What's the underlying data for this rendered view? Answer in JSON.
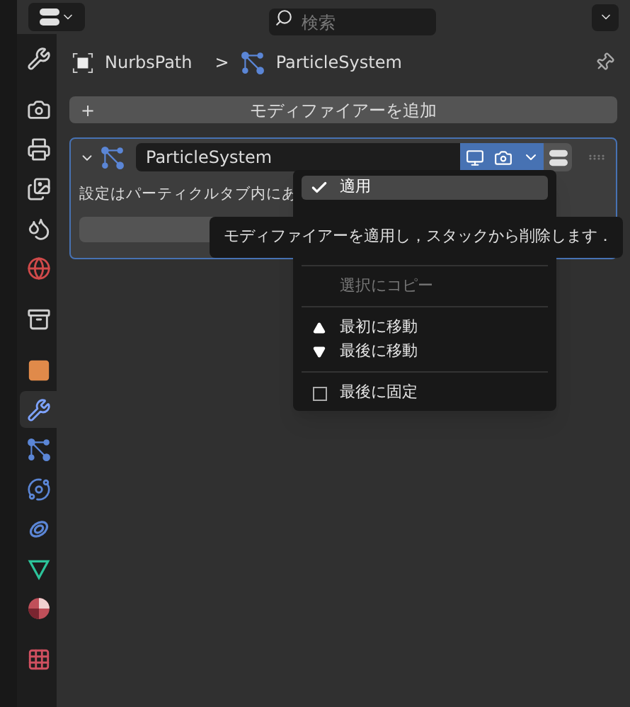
{
  "header": {
    "search": {
      "placeholder": "検索"
    }
  },
  "tabs": [
    {
      "kind": "tool",
      "selected": false
    },
    {
      "kind": "render",
      "selected": false
    },
    {
      "kind": "output",
      "selected": false
    },
    {
      "kind": "view_layer",
      "selected": false
    },
    {
      "kind": "scene",
      "selected": false
    },
    {
      "kind": "world",
      "selected": false
    },
    {
      "kind": "collection",
      "selected": false
    },
    {
      "kind": "object",
      "selected": false
    },
    {
      "kind": "modifier",
      "selected": true
    },
    {
      "kind": "particles",
      "selected": false
    },
    {
      "kind": "physics",
      "selected": false
    },
    {
      "kind": "constraints",
      "selected": false
    },
    {
      "kind": "data",
      "selected": false
    },
    {
      "kind": "material",
      "selected": false
    },
    {
      "kind": "texture",
      "selected": false
    }
  ],
  "breadcrumb": {
    "object": "NurbsPath",
    "separator": ">",
    "modifier": "ParticleSystem"
  },
  "add_modifier": {
    "icon": "+",
    "label": "モディファイアーを追加"
  },
  "modifier": {
    "name": "ParticleSystem",
    "expanded": true,
    "show_viewport": true,
    "show_render": true,
    "message": "設定はパーティクルタブ内にあ"
  },
  "menu": {
    "items": [
      {
        "kind": "apply",
        "label": "適用",
        "highlighted": true,
        "disabled": false
      },
      {
        "kind": "separator"
      },
      {
        "kind": "copy",
        "label": "選択にコピー",
        "highlighted": false,
        "disabled": true
      },
      {
        "kind": "separator"
      },
      {
        "kind": "move_first",
        "label": "最初に移動",
        "highlighted": false,
        "disabled": false
      },
      {
        "kind": "move_last",
        "label": "最後に移動",
        "highlighted": false,
        "disabled": false
      },
      {
        "kind": "separator"
      },
      {
        "kind": "pin",
        "label": "最後に固定",
        "highlighted": false,
        "disabled": false,
        "checked": false
      }
    ]
  },
  "tooltip": "モディファイアーを適用し，スタックから削除します．"
}
